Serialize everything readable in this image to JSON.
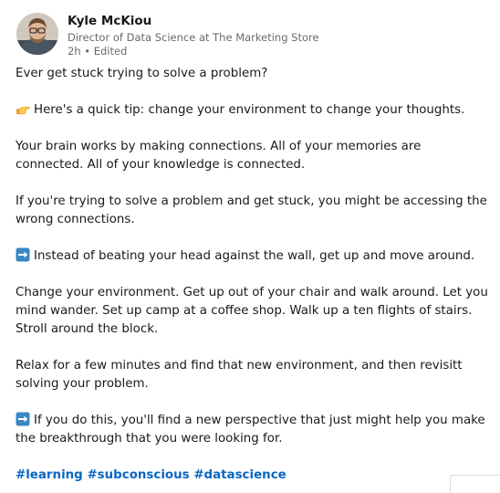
{
  "author": {
    "name": "Kyle McKiou",
    "title": "Director of Data Science at The Marketing Store",
    "time": "2h • Edited"
  },
  "post": {
    "p1": "Ever get stuck trying to solve a problem?",
    "p2": "Here's a quick tip: change your environment to change your thoughts.",
    "p3": "Your brain works by making connections. All of your memories are connected. All of your knowledge is connected.",
    "p4": "If you're trying to solve a problem and get stuck, you might be accessing the wrong connections.",
    "p5": "Instead of beating your head against the wall, get up and move around.",
    "p6": "Change your environment. Get up out of your chair and walk around. Let you mind wander. Set up camp at a coffee shop. Walk up a ten flights of stairs. Stroll around the block.",
    "p7": "Relax for a few minutes and find that new environment, and then revisitt solving your problem.",
    "p8": "If you do this, you'll find a new perspective that just might help you make the breakthrough that you were looking for."
  },
  "hashtags": [
    "#learning",
    "#subconscious",
    "#datascience"
  ],
  "icons": {
    "pointing": "pointing-hand-icon",
    "arrow": "right-arrow-icon"
  },
  "colors": {
    "hashtag": "#0a66c2",
    "arrow_bg": "#3b88c3"
  }
}
